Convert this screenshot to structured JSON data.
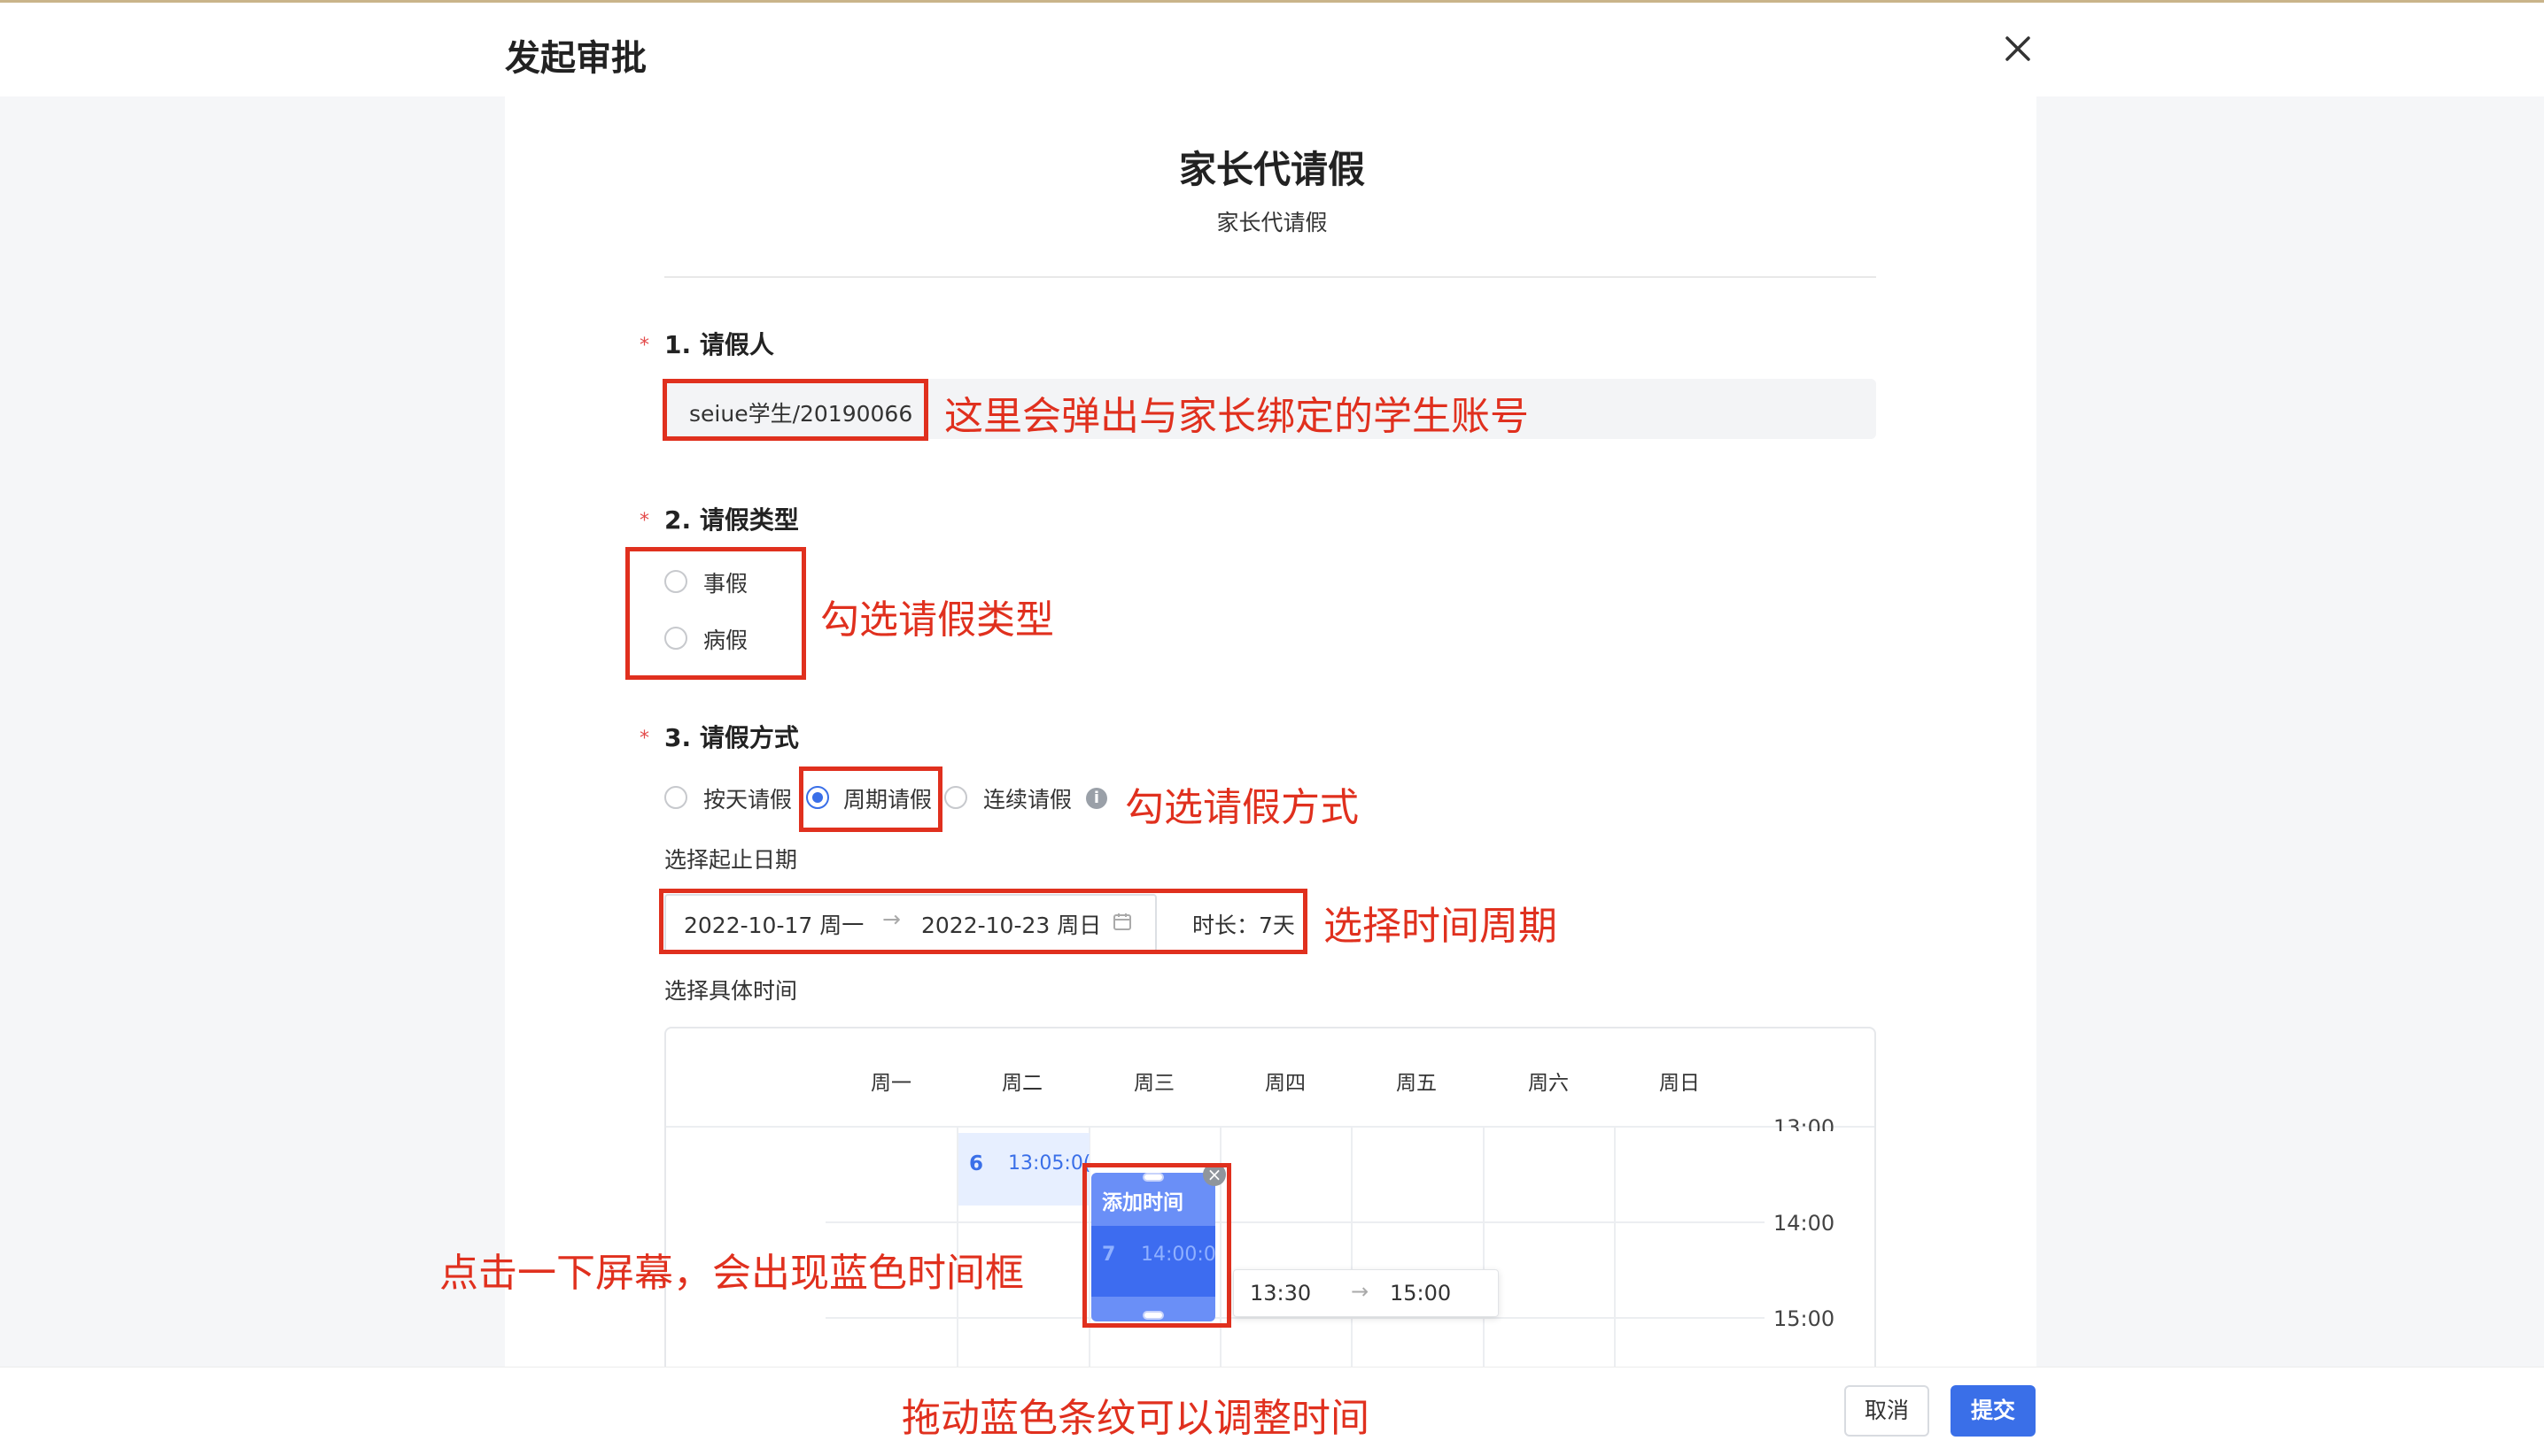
{
  "header": {
    "title": "发起审批",
    "close_icon": "close-icon"
  },
  "form": {
    "title": "家长代请假",
    "subtitle": "家长代请假"
  },
  "q1": {
    "label": "1. 请假人",
    "value": "seiue学生/20190066",
    "annotation": "这里会弹出与家长绑定的学生账号"
  },
  "q2": {
    "label": "2. 请假类型",
    "options": [
      "事假",
      "病假"
    ],
    "annotation": "勾选请假类型"
  },
  "q3": {
    "label": "3. 请假方式",
    "options": [
      "按天请假",
      "周期请假",
      "连续请假"
    ],
    "selected": "周期请假",
    "annotation": "勾选请假方式",
    "date_label": "选择起止日期",
    "start_date": "2022-10-17 周一",
    "end_date": "2022-10-23 周日",
    "duration": "时长：7天",
    "date_annotation": "选择时间周期",
    "time_label": "选择具体时间"
  },
  "calendar": {
    "days": [
      "周一",
      "周二",
      "周三",
      "周四",
      "周五",
      "周六",
      "周日"
    ],
    "times": [
      "13:00",
      "14:00",
      "15:00"
    ],
    "events": [
      {
        "number": "6",
        "time": "13:05:0("
      }
    ],
    "new_event": {
      "title": "添加时间",
      "number": "7",
      "time": "14:00:0("
    },
    "time_popup": {
      "start": "13:30",
      "end": "15:00"
    },
    "click_annotation": "点击一下屏幕，会出现蓝色时间框",
    "drag_annotation": "拖动蓝色条纹可以调整时间"
  },
  "footer": {
    "cancel_label": "取消",
    "submit_label": "提交"
  },
  "colors": {
    "annotation": "#e0301e",
    "primary": "#3a6fe8",
    "required": "#e34b4b"
  }
}
